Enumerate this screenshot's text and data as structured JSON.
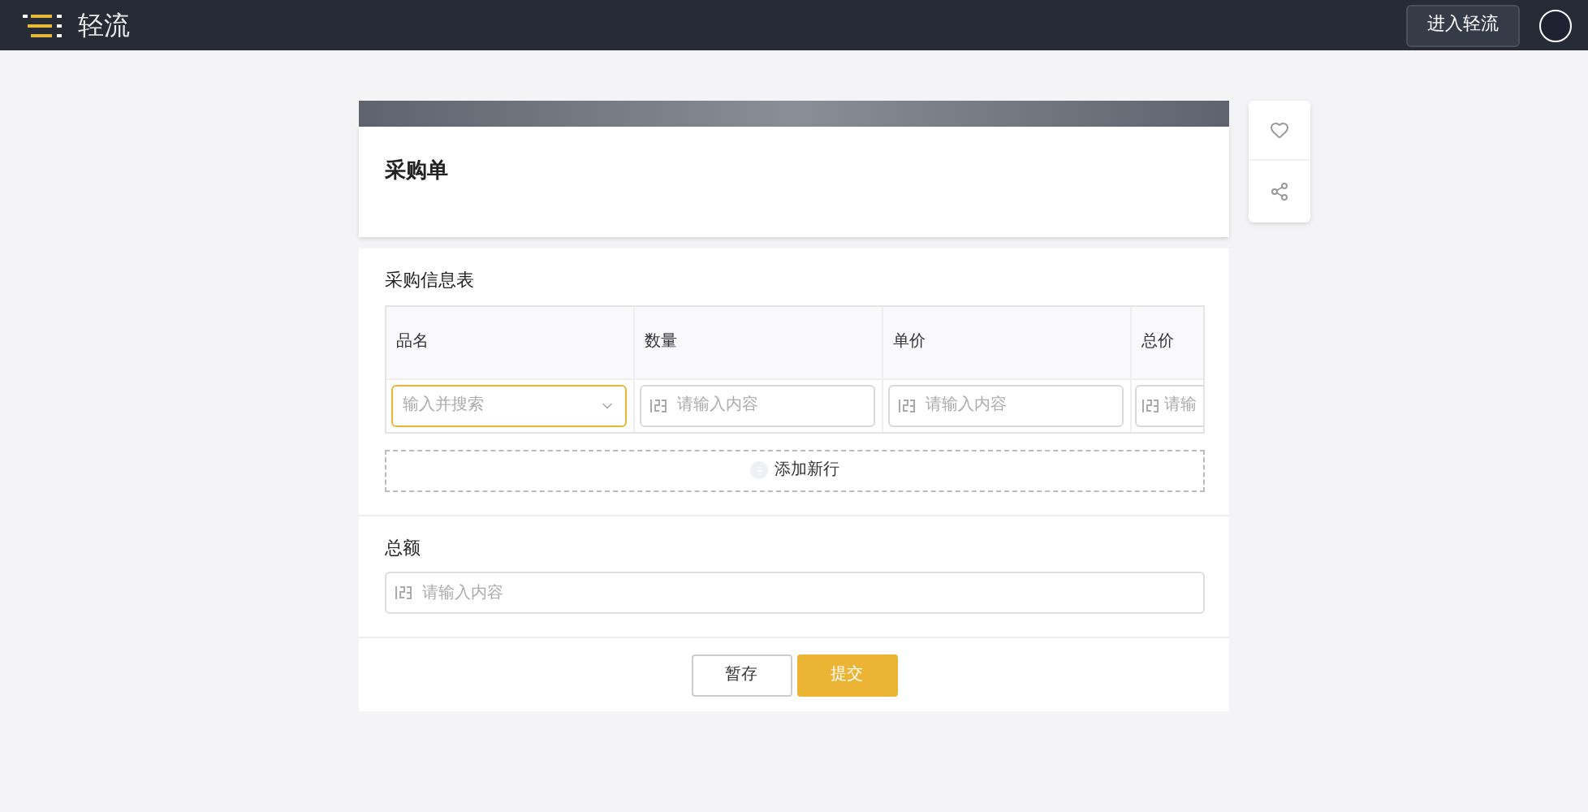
{
  "topbar": {
    "brand": "轻流",
    "enter_button": "进入轻流"
  },
  "form": {
    "title": "采购单",
    "table": {
      "title": "采购信息表",
      "columns": [
        "品名",
        "数量",
        "单价",
        "总价"
      ],
      "row": [
        {
          "kind": "select",
          "placeholder": "输入并搜索",
          "focused": true
        },
        {
          "kind": "number",
          "placeholder": "请输入内容",
          "focused": false
        },
        {
          "kind": "number",
          "placeholder": "请输入内容",
          "focused": false
        },
        {
          "kind": "number",
          "placeholder": "请输",
          "focused": false
        }
      ],
      "add_row": "添加新行"
    },
    "total": {
      "label": "总额",
      "placeholder": "请输入内容"
    },
    "buttons": [
      {
        "label": "暂存",
        "kind": "secondary"
      },
      {
        "label": "提交",
        "kind": "primary"
      }
    ]
  }
}
